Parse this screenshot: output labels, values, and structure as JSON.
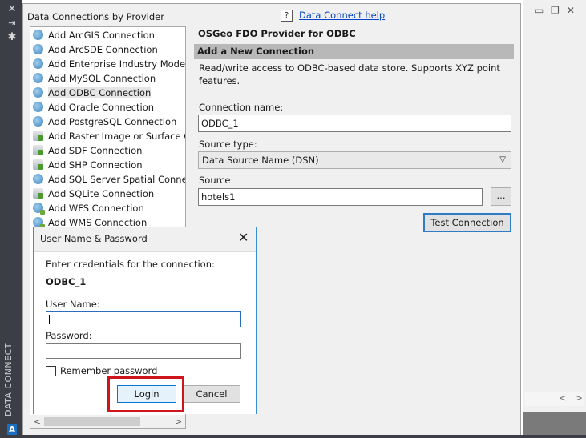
{
  "palette": {
    "vertical_title": "DATA CONNECT",
    "strip_icons": [
      "close-icon",
      "pin-icon",
      "settings-icon"
    ],
    "logo_letter": "A"
  },
  "tree": {
    "title": "Data Connections by Provider",
    "items": [
      {
        "label": "Add ArcGIS Connection",
        "icon": "globe"
      },
      {
        "label": "Add ArcSDE Connection",
        "icon": "globe"
      },
      {
        "label": "Add Enterprise Industry Model C",
        "icon": "globe"
      },
      {
        "label": "Add MySQL Connection",
        "icon": "globe"
      },
      {
        "label": "Add ODBC Connection",
        "icon": "globe",
        "selected": true
      },
      {
        "label": "Add Oracle Connection",
        "icon": "globe"
      },
      {
        "label": "Add PostgreSQL Connection",
        "icon": "globe"
      },
      {
        "label": "Add Raster Image or Surface Cor",
        "icon": "db"
      },
      {
        "label": "Add SDF Connection",
        "icon": "db"
      },
      {
        "label": "Add SHP Connection",
        "icon": "db"
      },
      {
        "label": "Add SQL Server Spatial Connecti",
        "icon": "globe"
      },
      {
        "label": "Add SQLite Connection",
        "icon": "db"
      },
      {
        "label": "Add WFS Connection",
        "icon": "globe-green"
      },
      {
        "label": "Add WMS Connection",
        "icon": "globe-green"
      }
    ]
  },
  "help": {
    "icon_text": "?",
    "link": "Data Connect help"
  },
  "provider": {
    "title": "OSGeo FDO Provider for ODBC",
    "section_header": "Add a New Connection",
    "description": "Read/write access to ODBC-based data store. Supports XYZ point features."
  },
  "form": {
    "connection_name_label": "Connection name:",
    "connection_name_value": "ODBC_1",
    "source_type_label": "Source type:",
    "source_type_value": "Data Source Name (DSN)",
    "source_label": "Source:",
    "source_value": "hotels1",
    "browse_label": "...",
    "test_button": "Test Connection"
  },
  "dialog": {
    "title": "User Name & Password",
    "prompt": "Enter credentials for the connection:",
    "connection": "ODBC_1",
    "user_label": "User Name:",
    "user_value": "",
    "password_label": "Password:",
    "password_value": "",
    "remember_label": "Remember password",
    "remember_checked": false,
    "login_button": "Login",
    "cancel_button": "Cancel"
  },
  "colors": {
    "highlight_box": "#d0141c",
    "link": "#0645c8",
    "focus_border": "#0078d7",
    "palette_dark": "#3b3f45"
  }
}
